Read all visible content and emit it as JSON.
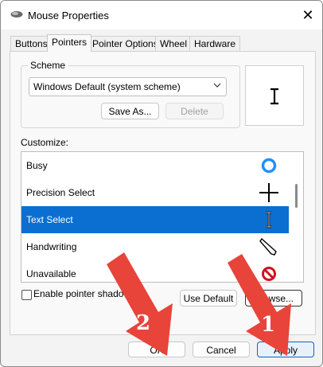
{
  "window": {
    "title": "Mouse Properties"
  },
  "tabs": [
    "Buttons",
    "Pointers",
    "Pointer Options",
    "Wheel",
    "Hardware"
  ],
  "active_tab": "Pointers",
  "scheme": {
    "label": "Scheme",
    "selected": "Windows Default (system scheme)",
    "save_as": "Save As...",
    "delete": "Delete"
  },
  "customize": {
    "label": "Customize:",
    "items": [
      {
        "label": "Busy",
        "icon": "busy-ring-icon"
      },
      {
        "label": "Precision Select",
        "icon": "crosshair-icon"
      },
      {
        "label": "Text Select",
        "icon": "text-beam-icon",
        "selected": true
      },
      {
        "label": "Handwriting",
        "icon": "pen-icon"
      },
      {
        "label": "Unavailable",
        "icon": "unavailable-icon"
      }
    ]
  },
  "shadow_label": "Enable pointer shadow",
  "shadow_checked": false,
  "use_default": "Use Default",
  "browse": "Browse...",
  "footer": {
    "ok": "OK",
    "cancel": "Cancel",
    "apply": "Apply"
  },
  "annotations": {
    "arrow1": "1",
    "arrow2": "2"
  },
  "colors": {
    "accent": "#0a6fd1",
    "arrow": "#e8443a"
  }
}
